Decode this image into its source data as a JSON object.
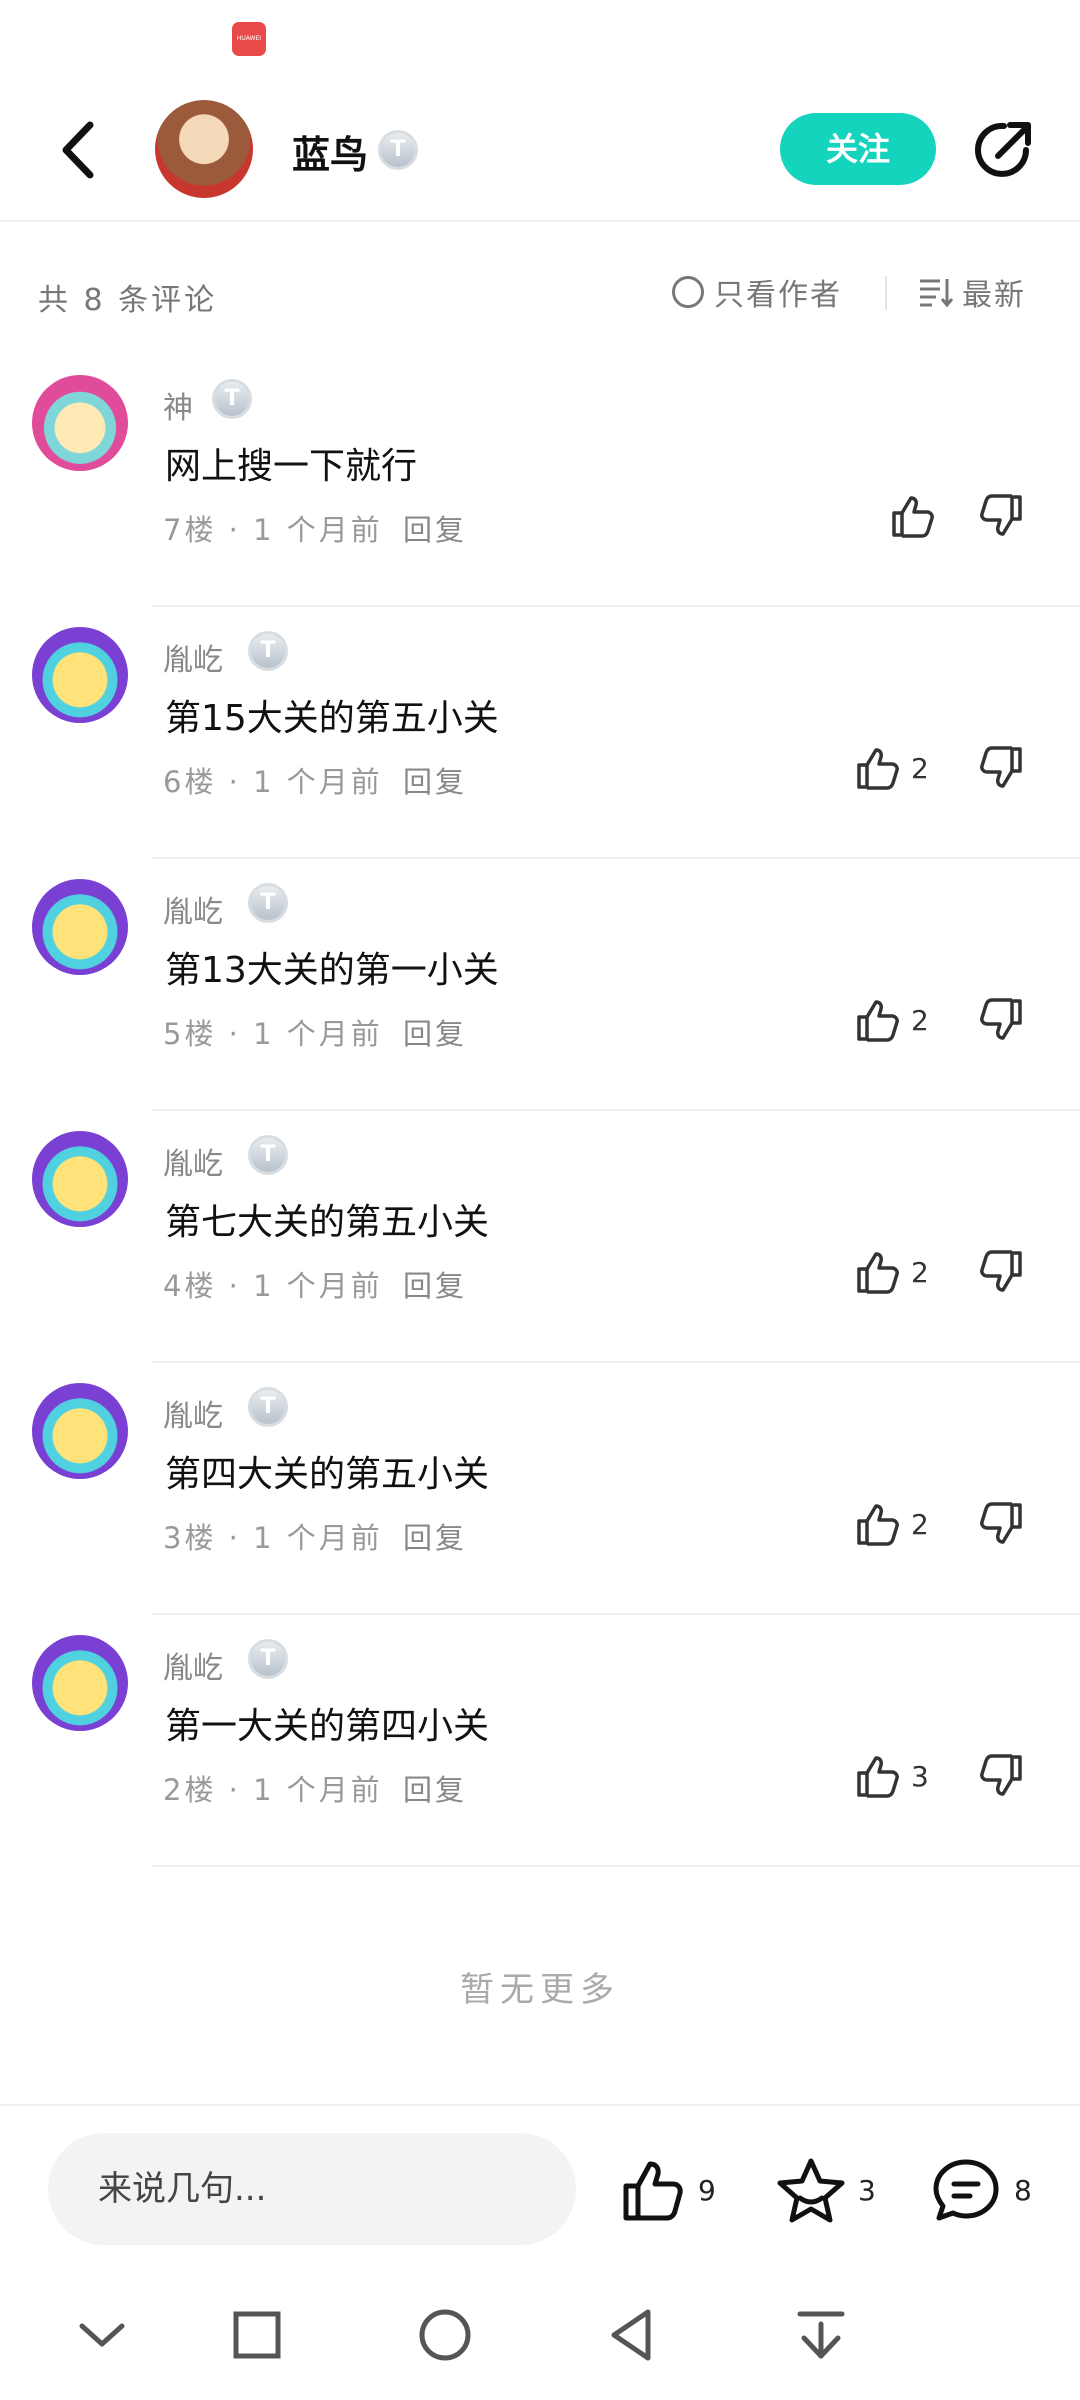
{
  "status_bar": {
    "app_icon_label": "HUAWEI"
  },
  "header": {
    "title": "蓝鸟",
    "badge": "T3",
    "badge_text": "T",
    "follow_label": "关注"
  },
  "comments_bar": {
    "count_label": "共 8 条评论",
    "only_author_label": "只看作者",
    "sort_label": "最新"
  },
  "comments": [
    {
      "user": "神",
      "badge": "T",
      "text": "网上搜一下就行",
      "floor": "7楼",
      "time": "1 个月前",
      "reply": "回复",
      "likes": ""
    },
    {
      "user": "胤屹",
      "badge": "T",
      "text": "第15大关的第五小关",
      "floor": "6楼",
      "time": "1 个月前",
      "reply": "回复",
      "likes": "2"
    },
    {
      "user": "胤屹",
      "badge": "T",
      "text": "第13大关的第一小关",
      "floor": "5楼",
      "time": "1 个月前",
      "reply": "回复",
      "likes": "2"
    },
    {
      "user": "胤屹",
      "badge": "T",
      "text": "第七大关的第五小关",
      "floor": "4楼",
      "time": "1 个月前",
      "reply": "回复",
      "likes": "2"
    },
    {
      "user": "胤屹",
      "badge": "T",
      "text": "第四大关的第五小关",
      "floor": "3楼",
      "time": "1 个月前",
      "reply": "回复",
      "likes": "2"
    },
    {
      "user": "胤屹",
      "badge": "T",
      "text": "第一大关的第四小关",
      "floor": "2楼",
      "time": "1 个月前",
      "reply": "回复",
      "likes": "3"
    }
  ],
  "footer_text": "暂无更多",
  "bottom_bar": {
    "input_placeholder": "来说几句...",
    "like_count": "9",
    "star_count": "3",
    "comment_count": "8"
  },
  "icons": {
    "back": "chevron-left-icon",
    "share": "share-icon",
    "like": "thumbs-up-icon",
    "dislike": "thumbs-down-icon",
    "star": "star-icon",
    "comment": "comment-bubble-icon"
  },
  "colors": {
    "accent": "#15d4bd"
  }
}
